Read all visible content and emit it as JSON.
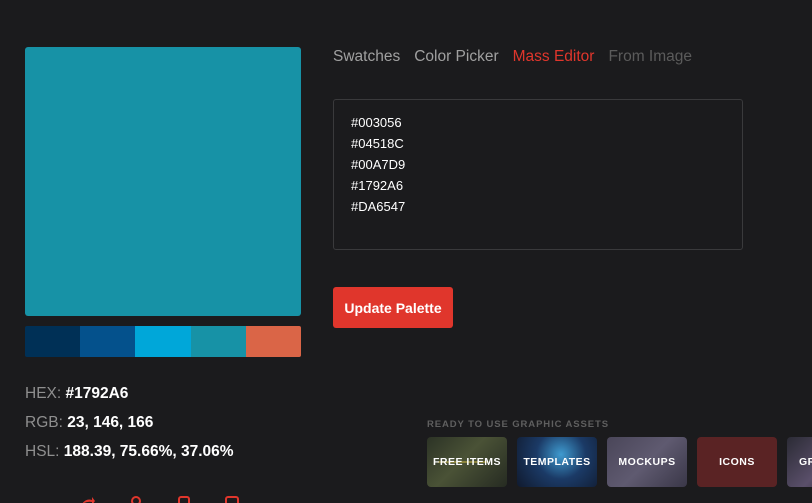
{
  "palette": {
    "selected": "#1792A6",
    "colors": [
      "#003056",
      "#04518C",
      "#00A7D9",
      "#1792A6",
      "#DA6547"
    ]
  },
  "info": {
    "hex_label": "HEX:",
    "hex_value": "#1792A6",
    "rgb_label": "RGB:",
    "rgb_value": "23, 146, 166",
    "hsl_label": "HSL:",
    "hsl_value": "188.39, 75.66%, 37.06%"
  },
  "tabs": [
    {
      "label": "Swatches",
      "state": "normal"
    },
    {
      "label": "Color Picker",
      "state": "normal"
    },
    {
      "label": "Mass Editor",
      "state": "active"
    },
    {
      "label": "From Image",
      "state": "disabled"
    }
  ],
  "editor": {
    "lines": [
      "#003056",
      "#04518C",
      "#00A7D9",
      "#1792A6",
      "#DA6547"
    ]
  },
  "update_button": "Update Palette",
  "assets": {
    "title": "READY TO USE GRAPHIC ASSETS",
    "items": [
      "FREE ITEMS",
      "TEMPLATES",
      "MOCKUPS",
      "ICONS",
      "GR"
    ]
  },
  "bottom_icons": [
    "share-icon",
    "pin-icon",
    "copy-icon",
    "save-icon"
  ],
  "colors": {
    "accent": "#E0362C",
    "background": "#1B1B1D"
  }
}
